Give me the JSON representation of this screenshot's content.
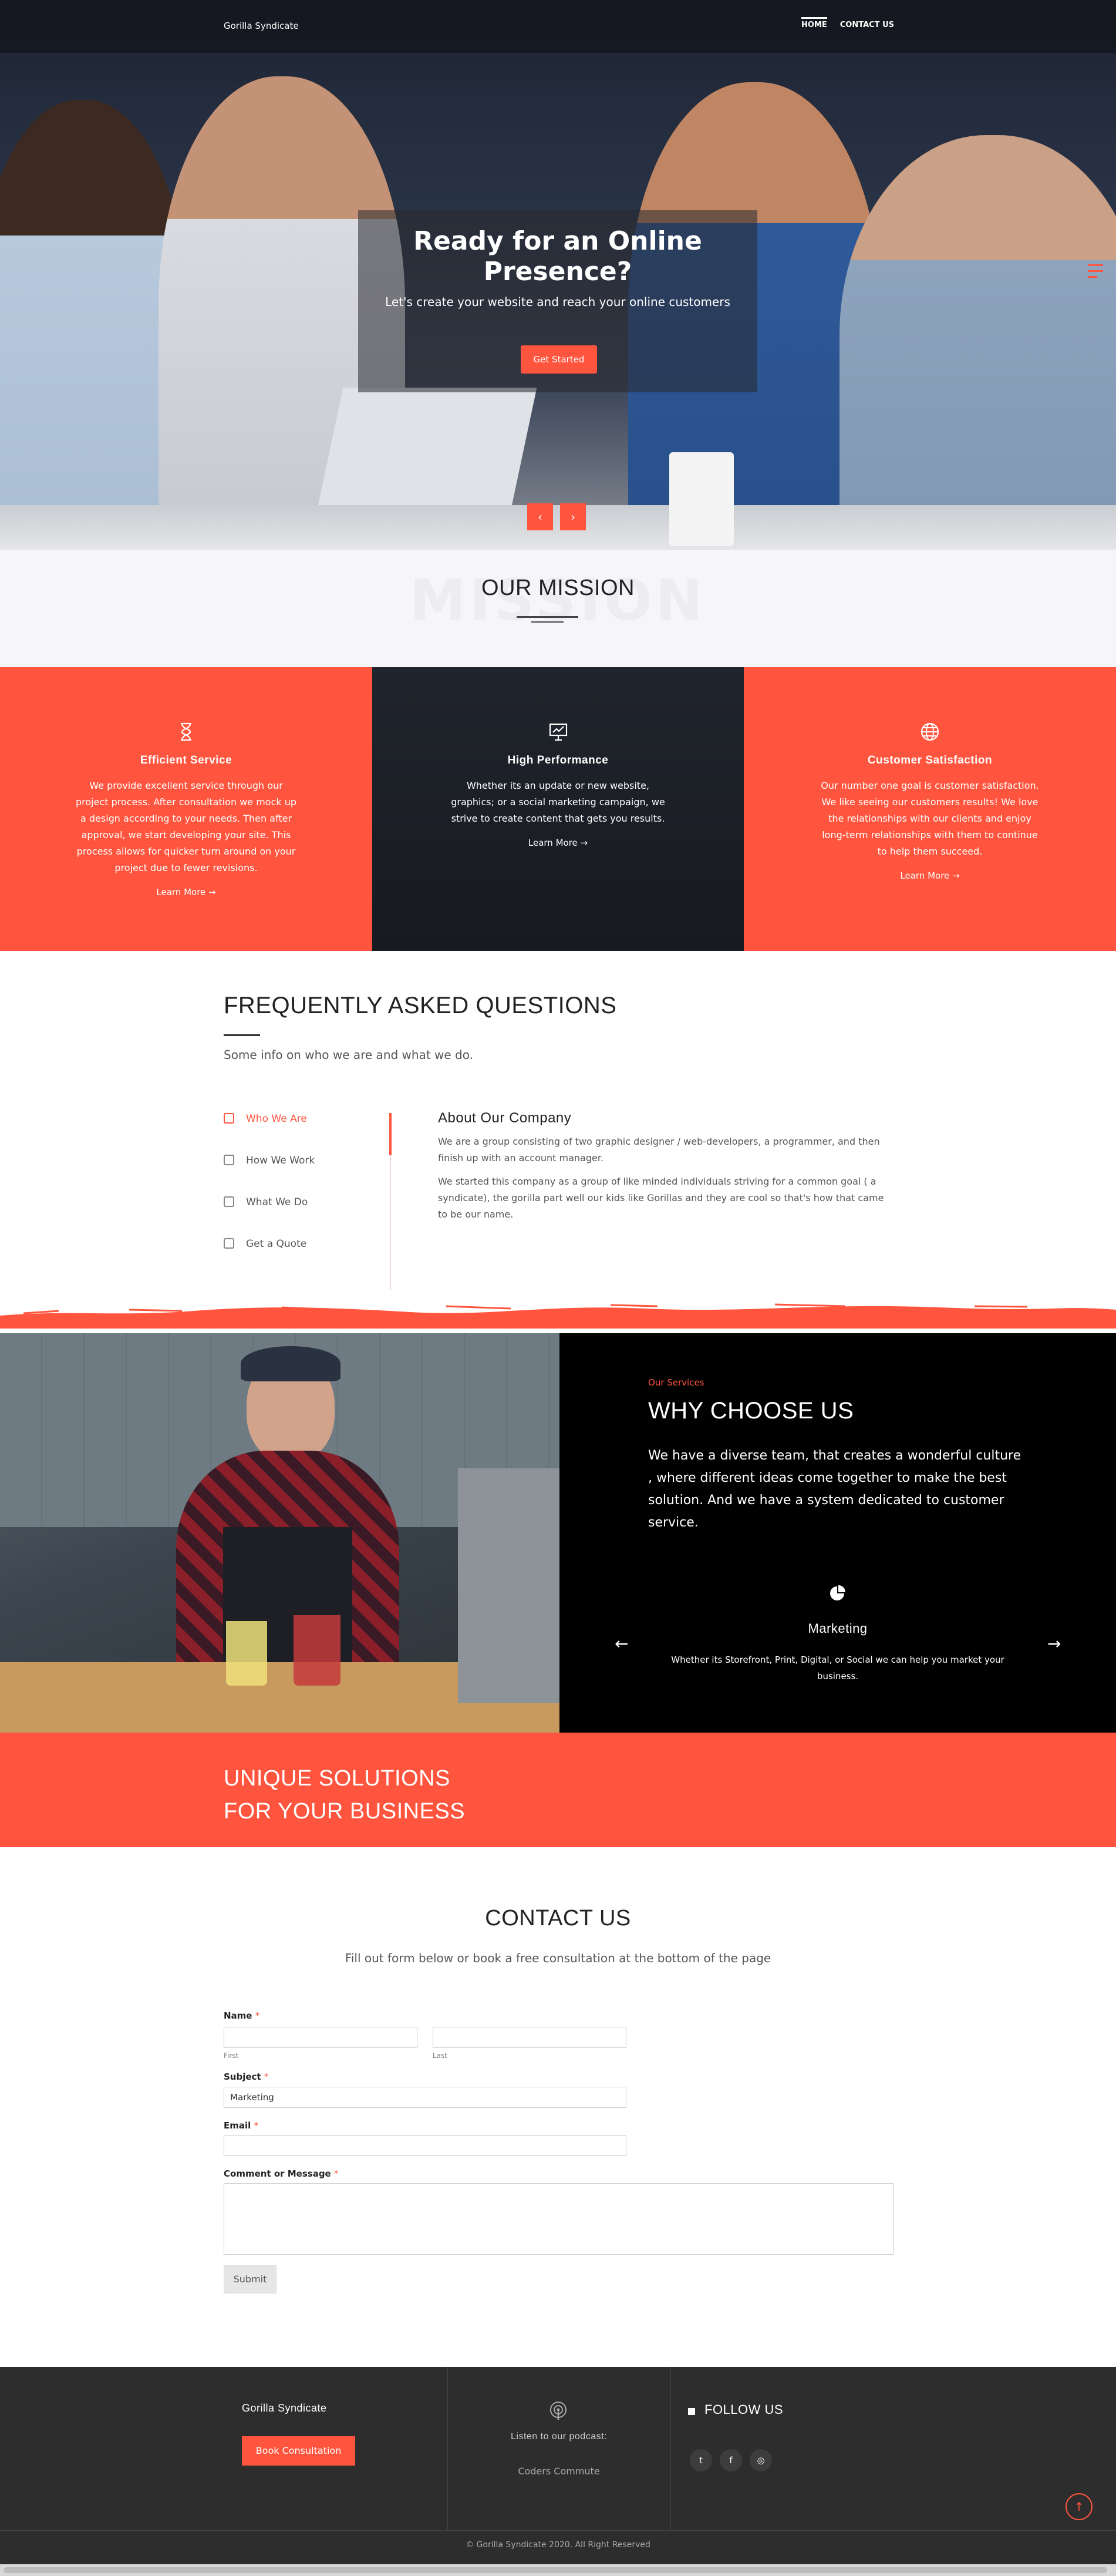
{
  "header": {
    "brand": "Gorilla Syndicate",
    "nav": [
      {
        "label": "HOME",
        "active": true
      },
      {
        "label": "CONTACT US",
        "active": false
      }
    ]
  },
  "hero": {
    "title": "Ready for an Online Presence?",
    "subtitle": "Let's create your website and reach your online customers",
    "cta": "Get Started",
    "prev_icon": "chevron-left-icon",
    "next_icon": "chevron-right-icon",
    "prev": "‹",
    "next": "›"
  },
  "mission": {
    "bg_word": "MISSION",
    "title": "OUR MISSION"
  },
  "features": [
    {
      "icon": "hourglass-icon",
      "title": "Efficient Service",
      "text": "We provide excellent service through our project process. After consultation we mock up a design according to your needs. Then after approval, we start developing your site. This process allows for quicker turn around on your project due to fewer revisions.",
      "link": "Learn More →",
      "bg": "#ff553e"
    },
    {
      "icon": "presentation-chart-icon",
      "title": "High Performance",
      "text": "Whether its an update or new website, graphics; or a social marketing campaign, we strive to create content that gets you results.",
      "link": "Learn More →",
      "bg": "#1c1f26"
    },
    {
      "icon": "globe-icon",
      "title": "Customer Satisfaction",
      "text": "Our number one goal is customer satisfaction. We like seeing our customers results! We love the relationships with our clients and enjoy long-term relationships with them to continue to help them succeed.",
      "link": "Learn More →",
      "bg": "#ff553e"
    }
  ],
  "faq": {
    "title": "FREQUENTLY ASKED QUESTIONS",
    "subtitle": "Some info on who we are and what we do.",
    "tabs": [
      "Who We Are",
      "How We Work",
      "What We Do",
      "Get a Quote"
    ],
    "active_tab": 0,
    "content_title": "About Our Company",
    "content_p1": "We are a group consisting of two graphic designer / web-developers, a programmer, and then finish up with an account manager.",
    "content_p2": "We started this company as a group of like minded individuals striving for a common goal ( a syndicate), the gorilla part well our kids like Gorillas and they are cool so that's how that came to be our name."
  },
  "why": {
    "eyebrow": "Our Services",
    "title": "WHY CHOOSE US",
    "text": "We have a diverse team, that creates a wonderful culture , where different ideas come together to make the best solution. And we have a system dedicated to customer service.",
    "service_icon": "pie-chart-icon",
    "service_title": "Marketing",
    "service_text": "Whether its Storefront, Print, Digital, or Social we can help you market your business.",
    "prev": "←",
    "next": "→"
  },
  "unique": {
    "line1": "UNIQUE SOLUTIONS",
    "line2": "FOR YOUR BUSINESS"
  },
  "contact": {
    "title": "CONTACT US",
    "subtitle": "Fill out form below or book a free consultation at the bottom of the page",
    "name_label": "Name",
    "first_hint": "First",
    "last_hint": "Last",
    "subject_label": "Subject",
    "subject_value": "Marketing",
    "email_label": "Email",
    "message_label": "Comment or Message",
    "required_mark": "*",
    "submit": "Submit"
  },
  "footer": {
    "brand": "Gorilla Syndicate",
    "book": "Book Consultation",
    "podcast_icon": "podcast-icon",
    "podcast_label": "Listen to our podcast:",
    "podcast_name": "Coders Commute",
    "follow": "FOLLOW US",
    "social": [
      {
        "icon": "twitter-icon",
        "glyph": "t"
      },
      {
        "icon": "facebook-icon",
        "glyph": "f"
      },
      {
        "icon": "instagram-icon",
        "glyph": "◎"
      }
    ],
    "copyright": "© Gorilla Syndicate 2020. All Right Reserved",
    "to_top": "↑"
  },
  "colors": {
    "accent": "#ff553e",
    "dark": "#2d2d2d",
    "black": "#000000"
  }
}
